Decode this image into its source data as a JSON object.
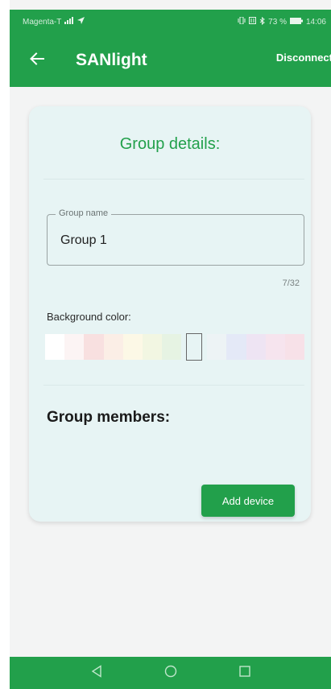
{
  "status_bar": {
    "carrier": "Magenta-T",
    "signal_icon": "signal-icon",
    "right_text": "73 %",
    "time": "14:06"
  },
  "app_bar": {
    "title": "SANlight",
    "action_label": "Disconnect",
    "back_icon": "arrow-left-icon"
  },
  "card": {
    "title": "Group details:",
    "group_name_label": "Group name",
    "group_name_value": "Group 1",
    "counter": "7/32",
    "background_label": "Background color:",
    "swatches": [
      "#ffffff",
      "#fcf4f4",
      "#f8e0e0",
      "#fbeee6",
      "#fcf8e6",
      "#f2f6e2",
      "#e6f3e3",
      "#edf3f5",
      "#e4e9f7",
      "#eee4f3",
      "#f6e4ee",
      "#f7e1e8"
    ],
    "selected_swatch_index": 7,
    "members_title": "Group members:",
    "add_button_label": "Add device"
  },
  "nav": {
    "back": "nav-back-icon",
    "home": "nav-home-icon",
    "recents": "nav-recents-icon"
  },
  "colors": {
    "brand_green": "#22a04b",
    "card_bg": "#e7f4f4"
  }
}
